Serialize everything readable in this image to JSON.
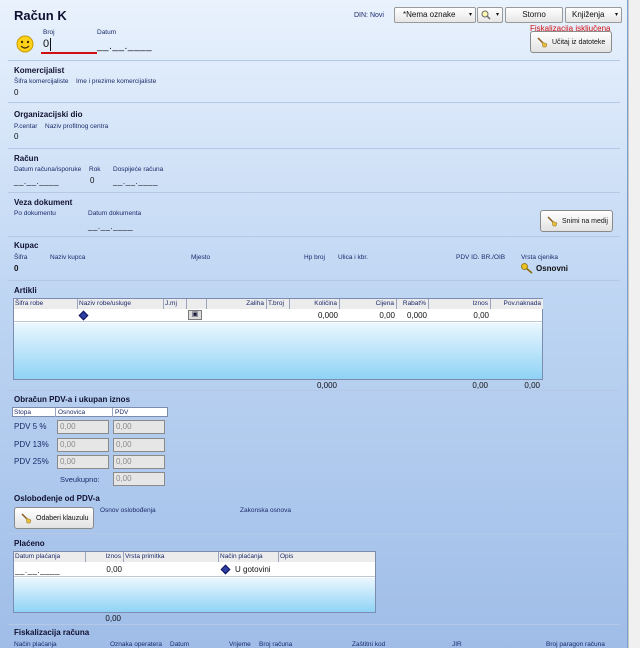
{
  "header": {
    "title": "Račun K",
    "din_label": "DIN: Novi",
    "tag_select": "*Nema oznake",
    "storno": "Storno",
    "knjizenja": "Knjiženja",
    "fisk_status": "Fiskalizacija isključena",
    "ucitaj": "Učitaj iz datoteke"
  },
  "broj": {
    "label": "Broj",
    "value": "0"
  },
  "datum": {
    "label": "Datum",
    "value": "__.__.____"
  },
  "komercijalist": {
    "title": "Komercijalist",
    "col1": "Šifra komercijaliste",
    "col2": "Ime i prezime komercijaliste",
    "value": "0"
  },
  "org": {
    "title": "Organizacijski dio",
    "col1": "P.centar",
    "col2": "Naziv profitnog centra",
    "value": "0"
  },
  "racun": {
    "title": "Račun",
    "col1": "Datum računa/isporuke",
    "col2": "Rok",
    "col3": "Dospijeće računa",
    "date1": "__.__.____",
    "rok": "0",
    "date2": "__.__.____"
  },
  "veza": {
    "title": "Veza dokument",
    "col1": "Po dokumentu",
    "col2": "Datum dokumenta",
    "date": "__.__.____",
    "snimi": "Snimi na medij"
  },
  "kupac": {
    "title": "Kupac",
    "sifra": "Šifra",
    "naziv": "Naziv kupca",
    "mjesto": "Mjesto",
    "hp": "Hp broj",
    "ulica": "Ulica i kbr.",
    "pdv_id": "PDV ID. BR./OIB",
    "vrsta": "Vrsta cjenika",
    "sifra_value": "0",
    "vrsta_value": "Osnovni"
  },
  "artikli": {
    "title": "Artikli",
    "columns": [
      "Šifra robe",
      "Naziv robe/usluge",
      "J.mj",
      "",
      "Zaliha",
      "T.broj",
      "Količina",
      "Cijena",
      "Rabat%",
      "Iznos",
      "Pov.naknada"
    ],
    "row": {
      "kolicina": "0,000",
      "cijena": "0,00",
      "rabat": "0,000",
      "iznos": "0,00"
    },
    "totals": {
      "kolicina": "0,000",
      "iznos": "0,00",
      "pov": "0,00"
    }
  },
  "pdv": {
    "title": "Obračun PDV-a i ukupan iznos",
    "headers": [
      "Stopa",
      "Osnovica",
      "PDV"
    ],
    "rows": [
      {
        "stopa": "PDV 5 %",
        "osnovica": "0,00",
        "pdv": "0,00"
      },
      {
        "stopa": "PDV 13%",
        "osnovica": "0,00",
        "pdv": "0,00"
      },
      {
        "stopa": "PDV 25%",
        "osnovica": "0,00",
        "pdv": "0,00"
      }
    ],
    "sveukupno_label": "Sveukupno:",
    "sveukupno": "0,00"
  },
  "oslobodenje": {
    "title": "Oslobođenje od PDV-a",
    "button": "Odaberi klauzulu",
    "osnov": "Osnov oslobođenja",
    "zakonska": "Zakonska osnova"
  },
  "placeno": {
    "title": "Plaćeno",
    "columns": [
      "Datum plaćanja",
      "Iznos",
      "Vrsta primitka",
      "Način plaćanja",
      "Opis"
    ],
    "row": {
      "datum": "__.__.____",
      "iznos": "0,00",
      "nacin": "U gotovini"
    },
    "total": "0,00"
  },
  "fiskal": {
    "title": "Fiskalizacija računa",
    "columns": [
      "Način plaćanja",
      "Oznaka operatera",
      "Datum",
      "Vrijeme",
      "Broj računa",
      "Zaštitni kod",
      "JIR",
      "Broj paragon računa"
    ]
  }
}
